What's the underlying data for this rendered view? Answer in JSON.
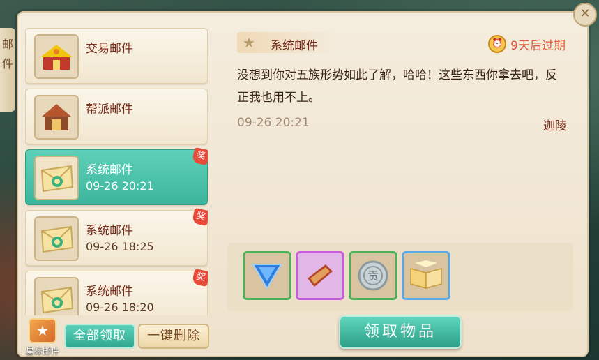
{
  "side_tab": {
    "chars": "邮\n件"
  },
  "mail_list": [
    {
      "title": "交易邮件",
      "date": "",
      "icon": "pavilion-icon",
      "selected": false,
      "reward": ""
    },
    {
      "title": "帮派邮件",
      "date": "",
      "icon": "guild-hall-icon",
      "selected": false,
      "reward": ""
    },
    {
      "title": "系统邮件",
      "date": "09-26 20:21",
      "icon": "envelope-icon",
      "selected": true,
      "reward": "奖"
    },
    {
      "title": "系统邮件",
      "date": "09-26 18:25",
      "icon": "envelope-icon",
      "selected": false,
      "reward": "奖"
    },
    {
      "title": "系统邮件",
      "date": "09-26 18:20",
      "icon": "envelope-icon",
      "selected": false,
      "reward": "奖"
    }
  ],
  "footer": {
    "star_mail_label": "星标邮件",
    "collect_all_label": "全部领取",
    "delete_all_label": "一键删除"
  },
  "detail": {
    "title": "系统邮件",
    "expire": "9天后过期",
    "body": "没想到你对五族形势如此了解，哈哈！这些东西你拿去吧，反正我也用不上。",
    "date": "09-26 20:21",
    "sender": "迦陵",
    "receive_label": "领取物品"
  },
  "attachments": [
    {
      "icon": "blue-gem-icon",
      "rarity": "green"
    },
    {
      "icon": "scroll-icon",
      "rarity": "purple"
    },
    {
      "icon": "silver-coin-icon",
      "rarity": "green"
    },
    {
      "icon": "open-book-icon",
      "rarity": "blue"
    }
  ],
  "colors": {
    "accent": "#3cb59c",
    "title_red": "#7a2b1a",
    "expire": "#e0593a"
  }
}
